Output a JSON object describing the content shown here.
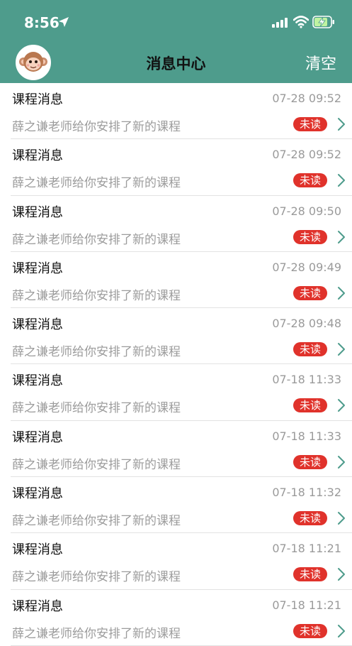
{
  "status_bar": {
    "time": "8:56"
  },
  "header": {
    "title": "消息中心",
    "clear_label": "清空"
  },
  "colors": {
    "header_bg": "#4e9c8c",
    "badge_bg": "#e0322b",
    "accent": "#4e9c8c"
  },
  "messages": [
    {
      "title": "课程消息",
      "time": "07-28 09:52",
      "preview": "薛之谦老师给你安排了新的课程",
      "badge": "未读"
    },
    {
      "title": "课程消息",
      "time": "07-28 09:52",
      "preview": "薛之谦老师给你安排了新的课程",
      "badge": "未读"
    },
    {
      "title": "课程消息",
      "time": "07-28 09:50",
      "preview": "薛之谦老师给你安排了新的课程",
      "badge": "未读"
    },
    {
      "title": "课程消息",
      "time": "07-28 09:49",
      "preview": "薛之谦老师给你安排了新的课程",
      "badge": "未读"
    },
    {
      "title": "课程消息",
      "time": "07-28 09:48",
      "preview": "薛之谦老师给你安排了新的课程",
      "badge": "未读"
    },
    {
      "title": "课程消息",
      "time": "07-18 11:33",
      "preview": "薛之谦老师给你安排了新的课程",
      "badge": "未读"
    },
    {
      "title": "课程消息",
      "time": "07-18 11:33",
      "preview": "薛之谦老师给你安排了新的课程",
      "badge": "未读"
    },
    {
      "title": "课程消息",
      "time": "07-18 11:32",
      "preview": "薛之谦老师给你安排了新的课程",
      "badge": "未读"
    },
    {
      "title": "课程消息",
      "time": "07-18 11:21",
      "preview": "薛之谦老师给你安排了新的课程",
      "badge": "未读"
    },
    {
      "title": "课程消息",
      "time": "07-18 11:21",
      "preview": "薛之谦老师给你安排了新的课程",
      "badge": "未读"
    }
  ]
}
